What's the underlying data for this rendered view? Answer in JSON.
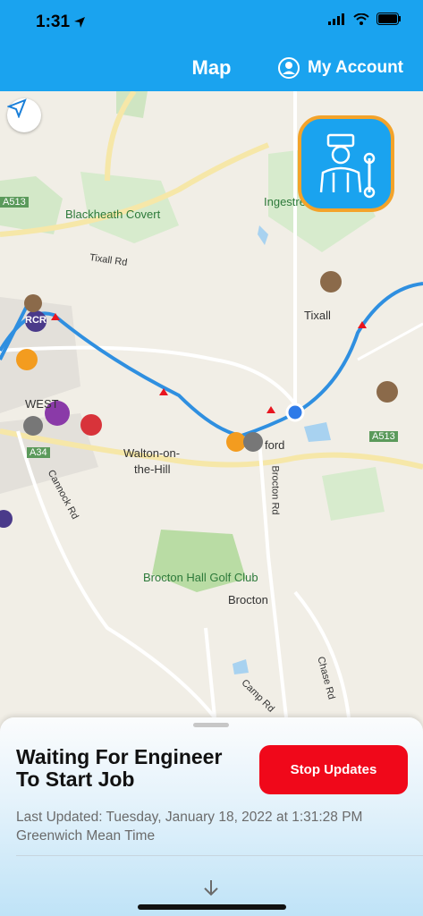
{
  "status_bar": {
    "time": "1:31"
  },
  "nav": {
    "title": "Map",
    "account_label": "My Account"
  },
  "map": {
    "labels": {
      "blackheath_covert": "Blackheath Covert",
      "ingestre": "Ingestre",
      "tixall_rd": "Tixall Rd",
      "tixall": "Tixall",
      "walton": "Walton-on-",
      "the_hill": "the-Hill",
      "brocton_hall": "Brocton Hall Golf Club",
      "brocton": "Brocton",
      "cannock_rd": "Cannock Rd",
      "brocton_rd": "Brocton Rd",
      "chase_rd": "Chase Rd",
      "camp_rd": "Camp Rd",
      "a513_left": "A513",
      "a513_right": "A513",
      "a34": "A34",
      "ford": "ford",
      "rcr": "RCR",
      "weston": "WEST"
    },
    "route_color": "#2f8fe0"
  },
  "panel": {
    "title": "Waiting For Engineer To Start Job",
    "stop_button": "Stop Updates",
    "last_updated": "Last Updated: Tuesday, January 18, 2022 at 1:31:28 PM Greenwich Mean Time"
  }
}
